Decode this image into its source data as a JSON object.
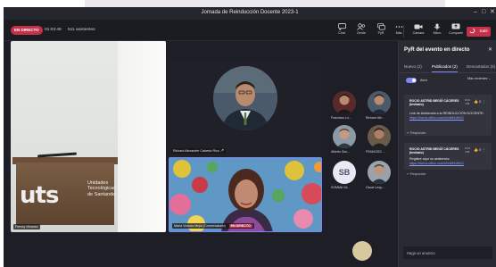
{
  "window": {
    "title": "Jornada de Reinducción Docente 2023-1"
  },
  "toolbar": {
    "live_badge": "EN DIRECTO",
    "timer": "01:03:49",
    "attendees": "511 asistentes",
    "buttons": [
      {
        "label": "Chat",
        "icon": "chat-icon"
      },
      {
        "label": "Gente",
        "icon": "people-icon"
      },
      {
        "label": "PyR",
        "icon": "qna-icon"
      },
      {
        "label": "Más",
        "icon": "more-icon"
      },
      {
        "label": "Cámara",
        "icon": "camera-icon"
      },
      {
        "label": "Micro",
        "icon": "mic-icon"
      },
      {
        "label": "Compartir",
        "icon": "share-icon"
      }
    ],
    "leave_label": "Salir"
  },
  "stage": {
    "room_label": "Ferney Virbador",
    "room_logo_big": "uts",
    "room_logo_text": [
      "Unidades",
      "Tecnológicas",
      "de Santander"
    ],
    "speaker_name": "Richard Alexander Caicedo Rico",
    "featured_name": "María Victoria Mejía (Conversatorio)",
    "featured_live": "EN DIRECTO",
    "participants": [
      {
        "name": "Francisco Lo..."
      },
      {
        "name": "Richard Ale..."
      },
      {
        "name": "Alberto San..."
      },
      {
        "name": "FRANCISS ..."
      },
      {
        "name": "SOMMA VA...",
        "initials": "SB"
      },
      {
        "name": "Oscar Leop..."
      }
    ]
  },
  "panel": {
    "title": "PyR del evento en directo",
    "tabs": [
      "Nuevo (2)",
      "Publicados (2)",
      "Descartados (0)"
    ],
    "toggle_label": "Abrir",
    "sort_label": "Más recientes",
    "posts": [
      {
        "author": "ROCIO ASTRID BEGÜÍ CÁCERES (Invitado)",
        "time": "8:01 PM",
        "likes": "0",
        "text": "Link de Asistencia a la REINDUCCIÓN DOCENTE:",
        "link": "https://forms.office.com/r/hn8fhtJ6KG",
        "reply": "Responder"
      },
      {
        "author": "ROCIO ASTRID BEGÜÍ CÁCERES (Invitado)",
        "time": "8:01 PM",
        "likes": "0",
        "text": "Registre aquí su asistencia:",
        "link": "https://forms.office.com/r/hn8fhtJ6KG",
        "reply": "Responder"
      }
    ],
    "ask_placeholder": "Haga un anuncio"
  },
  "colors": {
    "accent": "#7f85f5",
    "live": "#c4314b",
    "panel_bg": "#2a2a33",
    "stage_bg": "#1e1e26"
  }
}
